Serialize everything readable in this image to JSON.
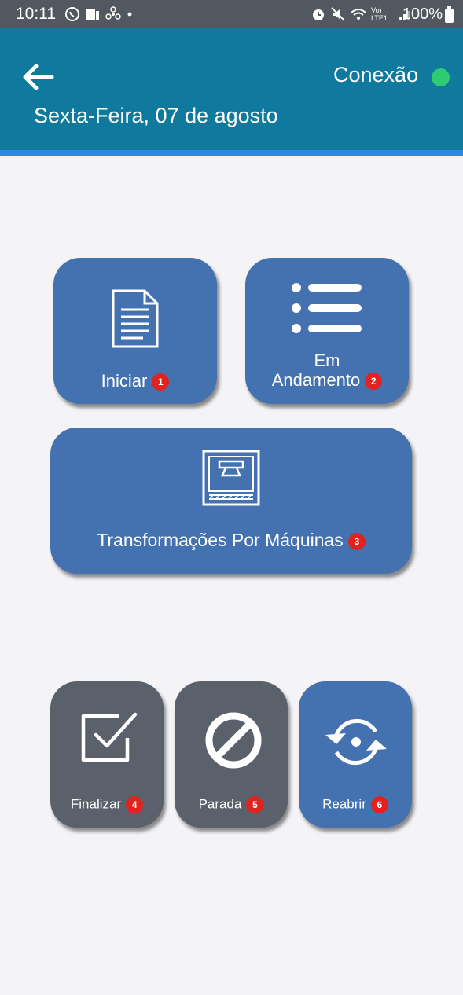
{
  "status_bar": {
    "time": "10:11",
    "battery": "100%",
    "network_label": "Vo) LTE1"
  },
  "header": {
    "connection_label": "Conexão",
    "connection_color": "#2ecc71",
    "date": "Sexta-Feira, 07 de agosto"
  },
  "tiles": {
    "iniciar": {
      "label": "Iniciar",
      "badge": "1",
      "icon": "document-icon"
    },
    "andamento": {
      "label_line1": "Em",
      "label_line2": "Andamento",
      "badge": "2",
      "icon": "list-icon"
    },
    "maquinas": {
      "label": "Transformações Por Máquinas",
      "badge": "3",
      "icon": "machine-icon"
    },
    "finalizar": {
      "label": "Finalizar",
      "badge": "4",
      "icon": "checkbox-icon"
    },
    "parada": {
      "label": "Parada",
      "badge": "5",
      "icon": "prohibited-icon"
    },
    "reabrir": {
      "label": "Reabrir",
      "badge": "6",
      "icon": "refresh-icon"
    }
  },
  "colors": {
    "app_bar": "#0f7a9e",
    "tile_blue": "#4472b0",
    "tile_gray": "#5a616a",
    "badge": "#e0231f"
  }
}
